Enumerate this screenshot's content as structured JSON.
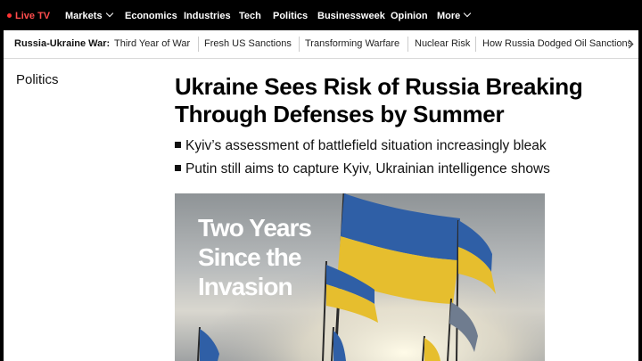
{
  "topnav": {
    "live_tv": "Live TV",
    "items": [
      "Markets",
      "Economics",
      "Industries",
      "Tech",
      "Politics",
      "Businessweek",
      "Opinion",
      "More"
    ]
  },
  "subnav": {
    "label": "Russia-Ukraine War:",
    "links": [
      "Third Year of War",
      "Fresh US Sanctions",
      "Transforming Warfare",
      "Nuclear Risk",
      "How Russia Dodged Oil Sanctions"
    ]
  },
  "article": {
    "section": "Politics",
    "headline": "Ukraine Sees Risk of Russia Breaking Through Defenses by Summer",
    "bullets": [
      "Kyiv’s assessment of battlefield situation increasingly bleak",
      "Putin still aims to capture Kyiv, Ukrainian intelligence shows"
    ],
    "hero_lines": [
      "Two Years",
      "Since the",
      "Invasion"
    ]
  },
  "colors": {
    "flag_blue": "#2f5fa6",
    "flag_yellow": "#e6be2e",
    "live_red": "#ff3333"
  }
}
